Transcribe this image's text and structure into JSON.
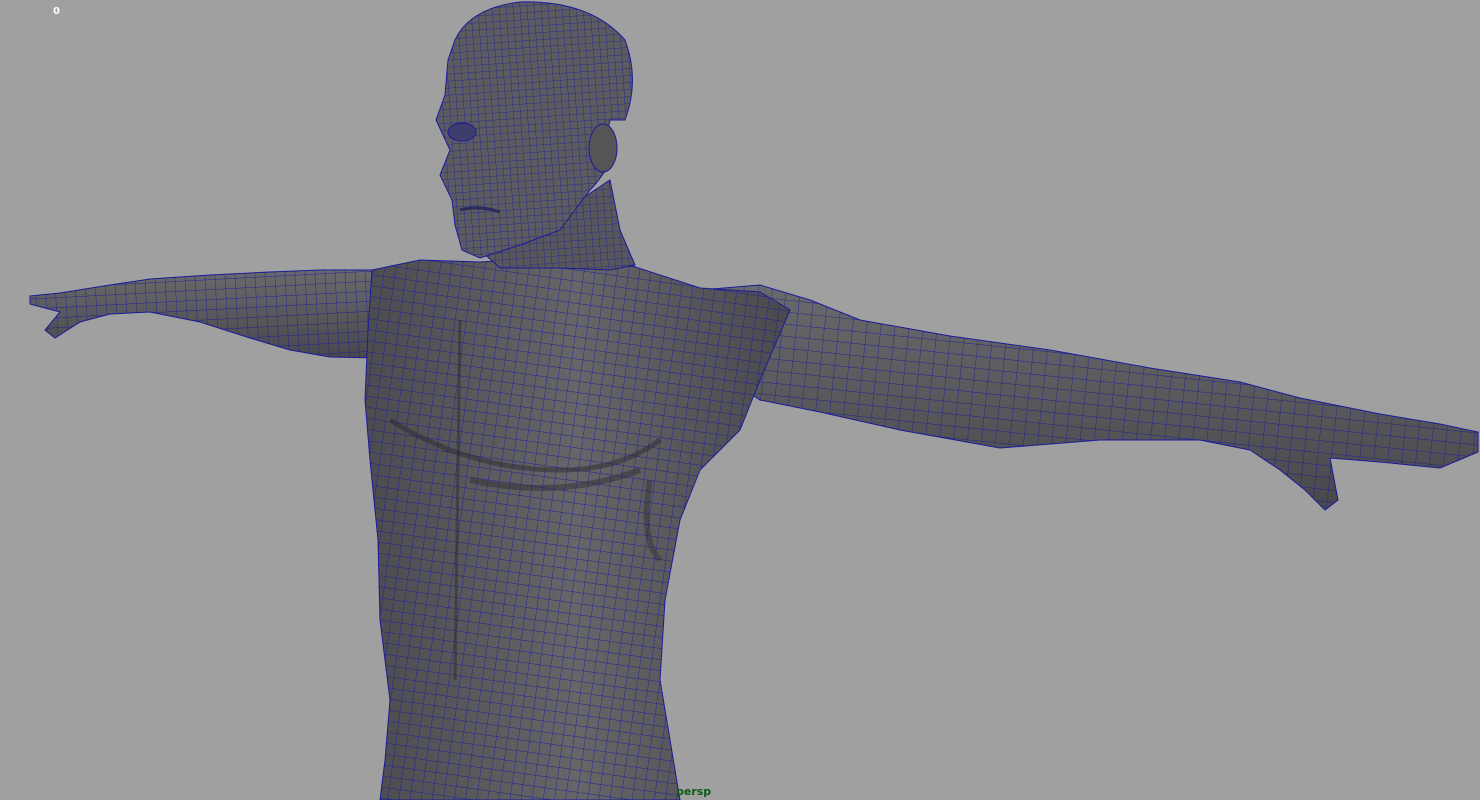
{
  "hud": {
    "frame_counter": "0"
  },
  "viewport": {
    "camera_name": "persp",
    "background_color": "#a0a0a0",
    "mesh_fill_color": "#5a5a5e",
    "wireframe_color": "#1a1a9a"
  }
}
